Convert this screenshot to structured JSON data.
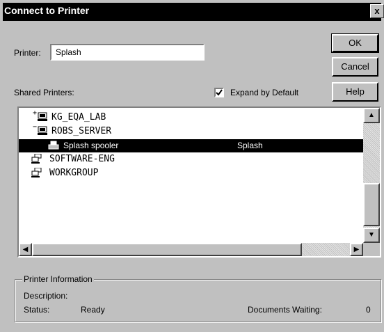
{
  "dialog": {
    "title": "Connect to Printer",
    "close_label": "x",
    "printer_label": "Printer:",
    "printer_value": "Splash",
    "shared_label": "Shared Printers:",
    "expand_label": "Expand by Default",
    "expand_checked": true,
    "buttons": {
      "ok": "OK",
      "cancel": "Cancel",
      "help": "Help"
    }
  },
  "tree": {
    "items": [
      {
        "name": "KG_EQA_LAB",
        "icon": "computer-icon",
        "expander": "+"
      },
      {
        "name": "ROBS_SERVER",
        "icon": "computer-icon",
        "expander": "−"
      },
      {
        "name": "Splash spooler",
        "comment": "Splash",
        "icon": "printer-icon",
        "selected": true
      },
      {
        "name": "SOFTWARE-ENG",
        "icon": "network-icon"
      },
      {
        "name": "WORKGROUP",
        "icon": "network-icon"
      }
    ]
  },
  "info": {
    "group_title": "Printer Information",
    "description_label": "Description:",
    "status_label": "Status:",
    "status_value": "Ready",
    "docs_label": "Documents Waiting:",
    "docs_value": "0"
  },
  "colors": {
    "selection": "#000000",
    "face": "#c0c0c0",
    "title_bar": "#000000"
  }
}
